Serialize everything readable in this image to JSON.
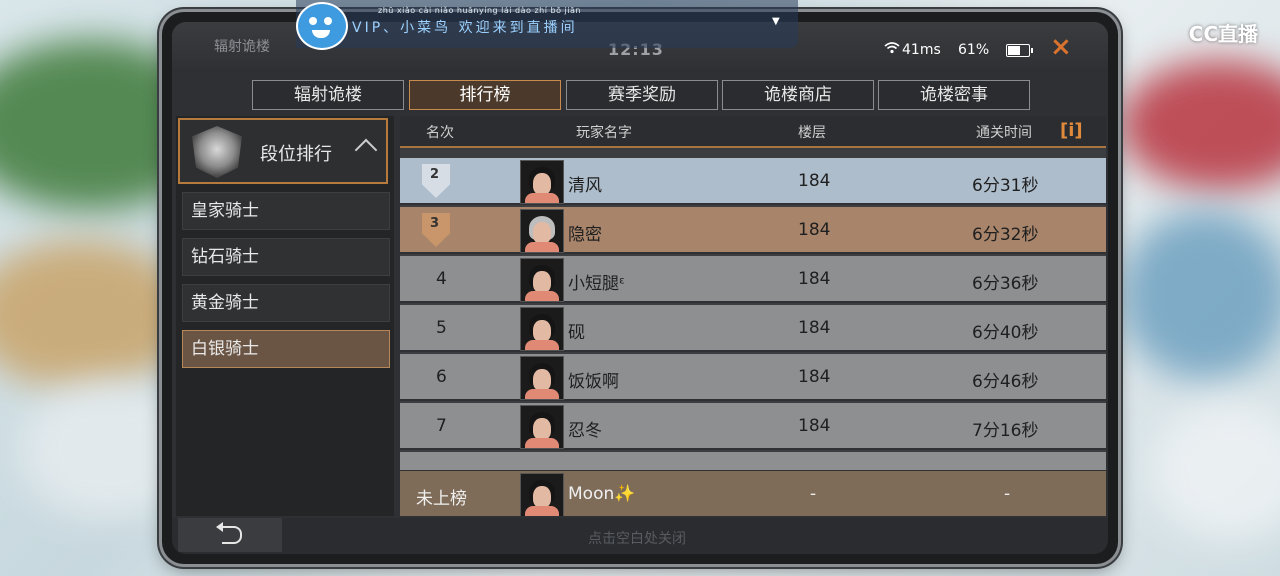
{
  "overlay": {
    "cc_logo": "CC直播",
    "vip_pinyin": "zhū xiǎo cài niǎo huānyíng lái dào zhí bō jiān",
    "vip_text": "VIP、小菜鸟 欢迎来到直播间"
  },
  "status": {
    "crumb": "辐射诡楼",
    "time": "12:13",
    "ping": "41ms",
    "battery_pct": "61%",
    "battery_level": 0.61,
    "close_label": "×"
  },
  "tabs": [
    {
      "label": "辐射诡楼",
      "active": false
    },
    {
      "label": "排行榜",
      "active": true
    },
    {
      "label": "赛季奖励",
      "active": false
    },
    {
      "label": "诡楼商店",
      "active": false
    },
    {
      "label": "诡楼密事",
      "active": false
    }
  ],
  "left": {
    "header": "段位排行",
    "tiers": [
      {
        "label": "皇家骑士",
        "active": false
      },
      {
        "label": "钻石骑士",
        "active": false
      },
      {
        "label": "黄金骑士",
        "active": false
      },
      {
        "label": "白银骑士",
        "active": true
      }
    ]
  },
  "table": {
    "headers": {
      "rank": "名次",
      "name": "玩家名字",
      "floor": "楼层",
      "time": "通关时间"
    },
    "info_icon": "i",
    "rows": [
      {
        "rank": "2",
        "name": "清风",
        "floor": "184",
        "time": "6分31秒"
      },
      {
        "rank": "3",
        "name": "隐密",
        "floor": "184",
        "time": "6分32秒"
      },
      {
        "rank": "4",
        "name": "小短腿ᵋ",
        "floor": "184",
        "time": "6分36秒"
      },
      {
        "rank": "5",
        "name": "砚",
        "floor": "184",
        "time": "6分40秒"
      },
      {
        "rank": "6",
        "name": "饭饭啊",
        "floor": "184",
        "time": "6分46秒"
      },
      {
        "rank": "7",
        "name": "忍冬",
        "floor": "184",
        "time": "7分16秒"
      }
    ],
    "me": {
      "rank": "未上榜",
      "name": "Moon✨",
      "floor": "-",
      "time": "-"
    }
  },
  "bottom": {
    "hint": "点击空白处关闭"
  },
  "colors": {
    "accent": "#c88a4d",
    "silver_row": "#aebdcc",
    "bronze_row": "#a7846a",
    "close": "#d9732e"
  }
}
